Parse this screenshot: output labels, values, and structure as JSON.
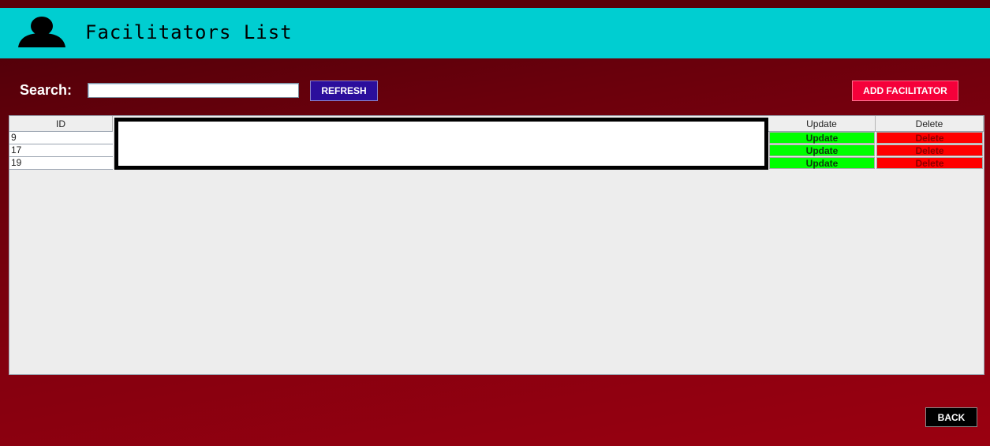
{
  "header": {
    "title": "Facilitators List",
    "icon": "user-silhouette-icon"
  },
  "search": {
    "label": "Search:",
    "value": "",
    "placeholder": ""
  },
  "toolbar": {
    "refresh_label": "REFRESH",
    "add_label": "ADD FACILITATOR",
    "back_label": "BACK"
  },
  "table": {
    "columns": [
      "ID",
      "Update",
      "Delete"
    ],
    "rows": [
      {
        "id": "9",
        "update": "Update",
        "delete": "Delete"
      },
      {
        "id": "17",
        "update": "Update",
        "delete": "Delete"
      },
      {
        "id": "19",
        "update": "Update",
        "delete": "Delete"
      }
    ]
  },
  "colors": {
    "header_bg": "#00ced1",
    "refresh_bg": "#2b0e9c",
    "add_bg": "#f5003a",
    "update_bg": "#00ff00",
    "delete_bg": "#ff0000",
    "back_bg": "#000000"
  }
}
